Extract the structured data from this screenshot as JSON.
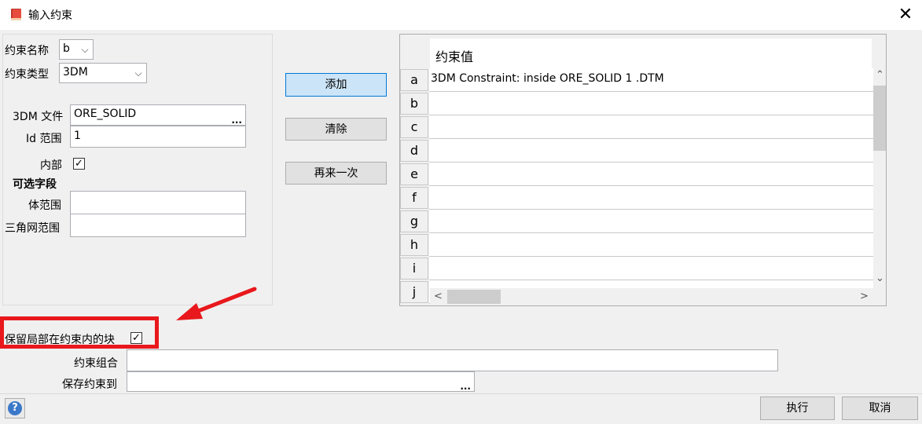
{
  "window": {
    "title": "输入约束",
    "close_glyph": "✕"
  },
  "form": {
    "constraint_name_label": "约束名称",
    "constraint_name_value": "b",
    "constraint_type_label": "约束类型",
    "constraint_type_value": "3DM",
    "file_label": "3DM 文件",
    "file_value": "ORE_SOLID",
    "browse_glyph": "...",
    "id_range_label": "Id 范围",
    "id_range_value": "1",
    "inside_label": "内部",
    "inside_checked": true,
    "optional_fields_label": "可选字段",
    "body_range_label": "体范围",
    "body_range_value": "",
    "tri_range_label": "三角网范围",
    "tri_range_value": ""
  },
  "buttons": {
    "add": "添加",
    "clear": "清除",
    "again": "再来一次",
    "execute": "执行",
    "cancel": "取消"
  },
  "grid": {
    "header": "约束值",
    "rows": [
      {
        "label": "a",
        "value": "3DM Constraint: inside ORE_SOLID 1 .DTM"
      },
      {
        "label": "b",
        "value": ""
      },
      {
        "label": "c",
        "value": ""
      },
      {
        "label": "d",
        "value": ""
      },
      {
        "label": "e",
        "value": ""
      },
      {
        "label": "f",
        "value": ""
      },
      {
        "label": "g",
        "value": ""
      },
      {
        "label": "h",
        "value": ""
      },
      {
        "label": "i",
        "value": ""
      },
      {
        "label": "j",
        "value": ""
      }
    ]
  },
  "bottom": {
    "keep_blocks_label": "保留局部在约束内的块",
    "keep_blocks_checked": true,
    "combination_label": "约束组合",
    "combination_value": "",
    "save_to_label": "保存约束到",
    "save_to_value": "",
    "browse_glyph": "..."
  },
  "glyphs": {
    "check": "✓",
    "chevron_down": "⌵",
    "up": "⌃",
    "down": "⌄",
    "left": "<",
    "right": ">",
    "help": "?"
  },
  "colors": {
    "annotation_red": "#e8181c",
    "primary_button": "#cce4f7",
    "help_icon": "#3a78c9"
  }
}
